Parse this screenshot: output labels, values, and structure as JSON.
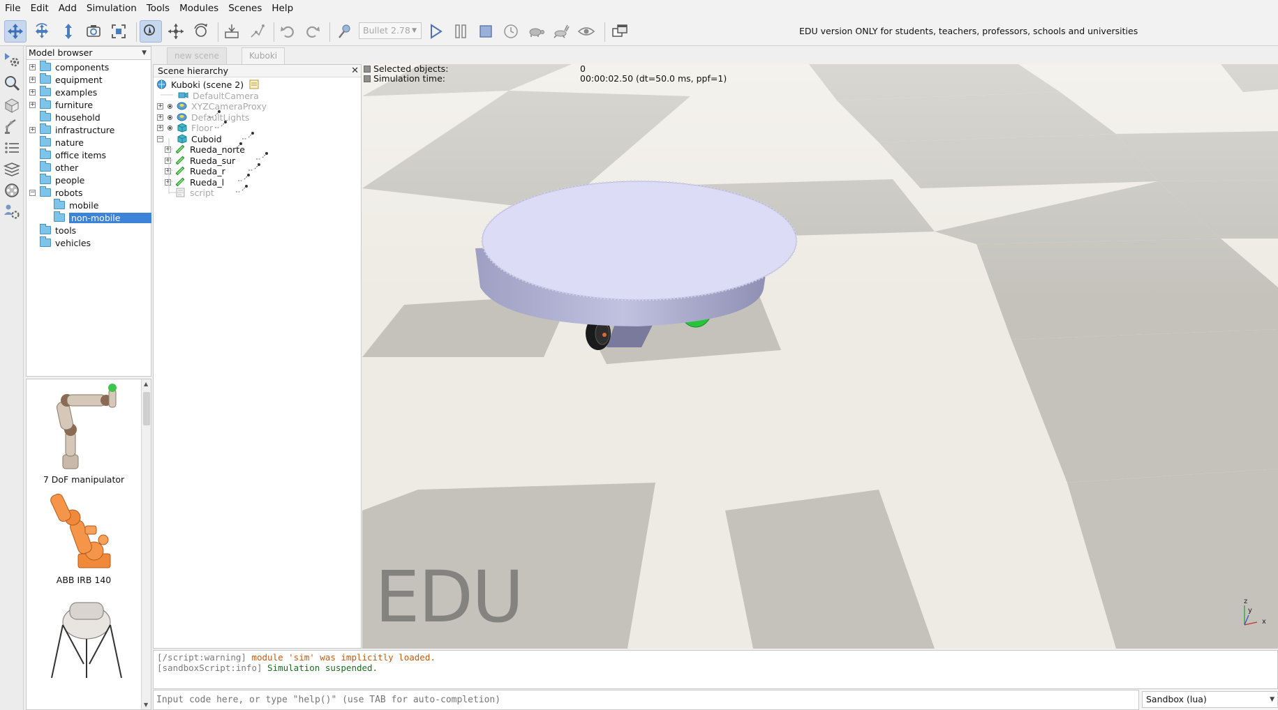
{
  "menu": [
    "File",
    "Edit",
    "Add",
    "Simulation",
    "Tools",
    "Modules",
    "Scenes",
    "Help"
  ],
  "toolbar": {
    "engine": "Bullet 2.78",
    "notice": "EDU version ONLY for students, teachers, professors, schools and universities"
  },
  "model_browser": {
    "title": "Model browser",
    "items": [
      {
        "label": "components",
        "expander": "+"
      },
      {
        "label": "equipment",
        "expander": "+"
      },
      {
        "label": "examples",
        "expander": "+"
      },
      {
        "label": "furniture",
        "expander": "+"
      },
      {
        "label": "household",
        "expander": ""
      },
      {
        "label": "infrastructure",
        "expander": "+"
      },
      {
        "label": "nature",
        "expander": ""
      },
      {
        "label": "office items",
        "expander": ""
      },
      {
        "label": "other",
        "expander": ""
      },
      {
        "label": "people",
        "expander": ""
      },
      {
        "label": "robots",
        "expander": "−"
      },
      {
        "label": "mobile",
        "expander": ""
      },
      {
        "label": "non-mobile",
        "expander": ""
      },
      {
        "label": "tools",
        "expander": ""
      },
      {
        "label": "vehicles",
        "expander": ""
      }
    ],
    "selected": "non-mobile"
  },
  "models": [
    {
      "name": "7 DoF manipulator"
    },
    {
      "name": "ABB IRB 140"
    }
  ],
  "scene_tabs": [
    "new scene",
    "Kuboki"
  ],
  "hierarchy": {
    "title": "Scene hierarchy",
    "root": "Kuboki (scene 2)",
    "items": [
      {
        "label": "DefaultCamera"
      },
      {
        "label": "XYZCameraProxy"
      },
      {
        "label": "DefaultLights"
      },
      {
        "label": "Floor"
      },
      {
        "label": "Cuboid"
      },
      {
        "label": "Rueda_norte"
      },
      {
        "label": "Rueda_sur"
      },
      {
        "label": "Rueda_r"
      },
      {
        "label": "Rueda_l"
      },
      {
        "label": "script"
      }
    ]
  },
  "viewport": {
    "selected_label": "Selected objects:",
    "selected_value": "0",
    "sim_time_label": "Simulation time:",
    "sim_time_value": "00:00:02.50 (dt=50.0 ms, ppf=1)",
    "watermark": "EDU",
    "axis_labels": {
      "z": "z",
      "y": "y",
      "x": "x"
    }
  },
  "console": {
    "line1_tag": "[/script:warning]",
    "line1_msg": "module 'sim' was implicitly loaded.",
    "line2_tag": "[sandboxScript:info]",
    "line2_msg": "Simulation suspended."
  },
  "command": {
    "placeholder": "Input code here, or type \"help()\" (use TAB for auto-completion)",
    "sandbox": "Sandbox (lua)"
  }
}
